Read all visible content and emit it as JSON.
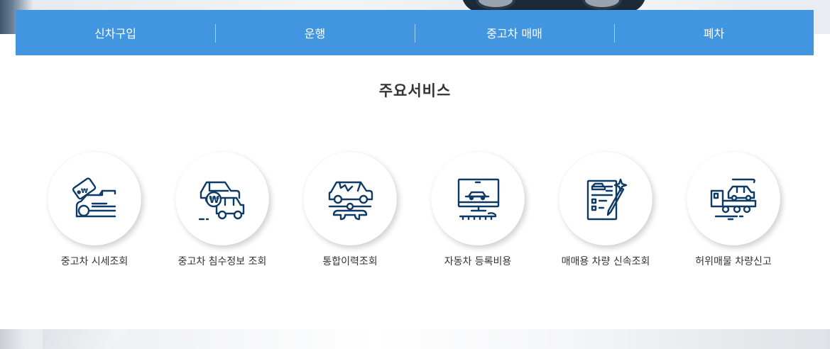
{
  "nav": {
    "items": [
      {
        "label": "신차구입"
      },
      {
        "label": "운행"
      },
      {
        "label": "중고차 매매"
      },
      {
        "label": "폐차"
      }
    ]
  },
  "section": {
    "title": "주요서비스"
  },
  "services": [
    {
      "label": "중고차 시세조회",
      "icon": "car-price-tag-icon"
    },
    {
      "label": "중고차 침수정보 조회",
      "icon": "cars-won-icon"
    },
    {
      "label": "통합이력조회",
      "icon": "car-repair-wrench-icon"
    },
    {
      "label": "자동차 등록비용",
      "icon": "monitor-car-icon"
    },
    {
      "label": "매매용 차량 신속조회",
      "icon": "document-pen-icon"
    },
    {
      "label": "허위매물 차량신고",
      "icon": "tow-truck-icon"
    }
  ],
  "colors": {
    "nav_bg": "#4296e0",
    "icon_stroke": "#0e3a66",
    "text": "#333333"
  }
}
